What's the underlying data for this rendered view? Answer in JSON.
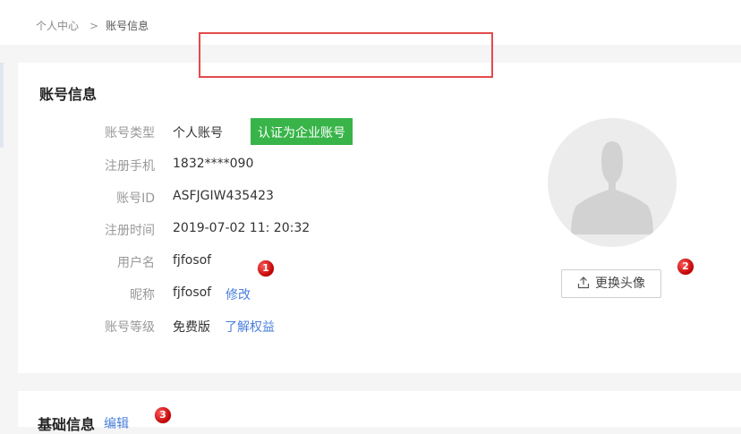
{
  "breadcrumb": {
    "root": "个人中心",
    "separator": ">",
    "current": "账号信息"
  },
  "account_card": {
    "title": "账号信息",
    "fields": [
      {
        "label": "账号类型",
        "value": "个人账号"
      },
      {
        "label": "注册手机",
        "value": "1832****090"
      },
      {
        "label": "账号ID",
        "value": "ASFJGIW435423"
      },
      {
        "label": "注册时间",
        "value": "2019-07-02 11: 20:32"
      },
      {
        "label": "用户名",
        "value": "fjfosof"
      },
      {
        "label": "昵称",
        "value": "fjfosof"
      },
      {
        "label": "账号等级",
        "value": "免费版"
      }
    ],
    "certify_button": "认证为企业账号",
    "edit_nickname_link": "修改",
    "benefits_link": "了解权益",
    "change_avatar_button": "更换头像",
    "avatar_icon": "default-user-silhouette",
    "upload_icon": "upload-icon"
  },
  "basic_info_card": {
    "title": "基础信息",
    "edit_link": "编辑"
  },
  "annotations": [
    "1",
    "2",
    "3"
  ],
  "colors": {
    "accent_green": "#38b449",
    "link_blue": "#4a7fdc",
    "highlight_red": "#e44a4a",
    "badge_red": "#d10000"
  }
}
